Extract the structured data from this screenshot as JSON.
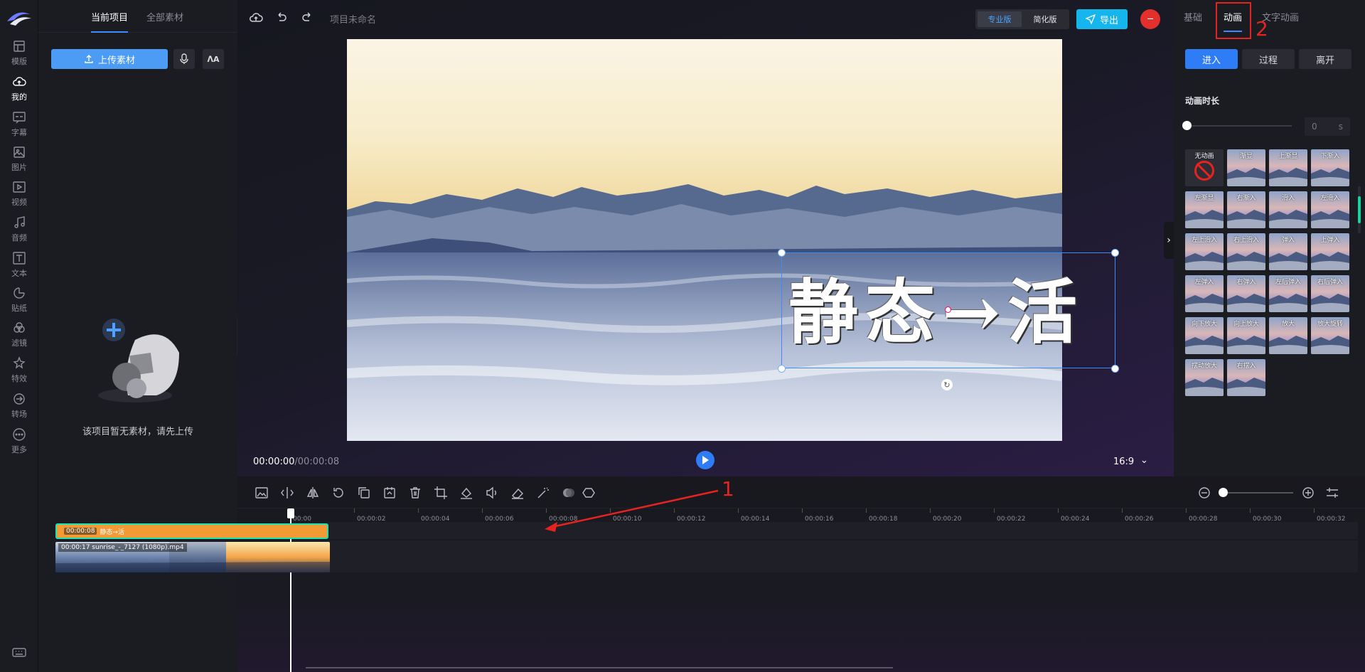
{
  "rail": {
    "items": [
      {
        "label": "模版",
        "icon": "template-icon"
      },
      {
        "label": "我的",
        "icon": "cloud-upload-icon",
        "active": true
      },
      {
        "label": "字幕",
        "icon": "subtitle-icon"
      },
      {
        "label": "图片",
        "icon": "image-icon"
      },
      {
        "label": "视频",
        "icon": "video-icon"
      },
      {
        "label": "音频",
        "icon": "music-icon"
      },
      {
        "label": "文本",
        "icon": "text-icon"
      },
      {
        "label": "贴纸",
        "icon": "sticker-icon"
      },
      {
        "label": "滤镜",
        "icon": "filter-icon"
      },
      {
        "label": "特效",
        "icon": "effect-icon"
      },
      {
        "label": "转场",
        "icon": "transition-icon"
      },
      {
        "label": "更多",
        "icon": "more-icon"
      }
    ]
  },
  "materials": {
    "tabs": [
      "当前项目",
      "全部素材"
    ],
    "upload_label": "上传素材",
    "empty_text": "该项目暂无素材，请先上传"
  },
  "topbar": {
    "project_name": "项目未命名",
    "pro_label": "专业版",
    "simple_label": "简化版",
    "export_label": "导出"
  },
  "canvas": {
    "title_text": "静态→活"
  },
  "player": {
    "current_time": "00:00:00",
    "total_time": "/00:00:08",
    "ratio": "16:9"
  },
  "right_panel": {
    "tabs": [
      "基础",
      "动画",
      "文字动画"
    ],
    "active_tab": "动画",
    "segments": [
      "进入",
      "过程",
      "离开"
    ],
    "duration_label": "动画时长",
    "duration_value": "0",
    "duration_unit": "s",
    "animations": [
      "无动画",
      "渐显",
      "上渐显",
      "下渐入",
      "左渐显",
      "右渐入",
      "滑入",
      "左滑入",
      "左上滑入",
      "右上滑入",
      "弹入",
      "上弹入",
      "左弹入",
      "右弹入",
      "左后弹入",
      "右后弹入",
      "向下放大",
      "向上放大",
      "放大",
      "放大旋转",
      "摆动放大",
      "右摆入"
    ]
  },
  "annotations": {
    "num1": "1",
    "num2": "2",
    "accent_color": "#e52320"
  },
  "timeline": {
    "ticks": [
      "00:00",
      "00:00:02",
      "00:00:04",
      "00:00:06",
      "00:00:08",
      "00:00:10",
      "00:00:12",
      "00:00:14",
      "00:00:16",
      "00:00:18",
      "00:00:20",
      "00:00:22",
      "00:00:24",
      "00:00:26",
      "00:00:28",
      "00:00:30",
      "00:00:32"
    ],
    "text_clip": {
      "duration": "00:00:08",
      "name": "静态→活"
    },
    "video_clip": {
      "duration": "00:00:17",
      "name": "sunrise_-_7127 (1080p).mp4"
    }
  },
  "colors": {
    "primary_blue": "#2f7df6",
    "export_cyan": "#15b5ee",
    "text_clip_orange": "#f39a35",
    "clip_border_teal": "#1de3b4"
  }
}
